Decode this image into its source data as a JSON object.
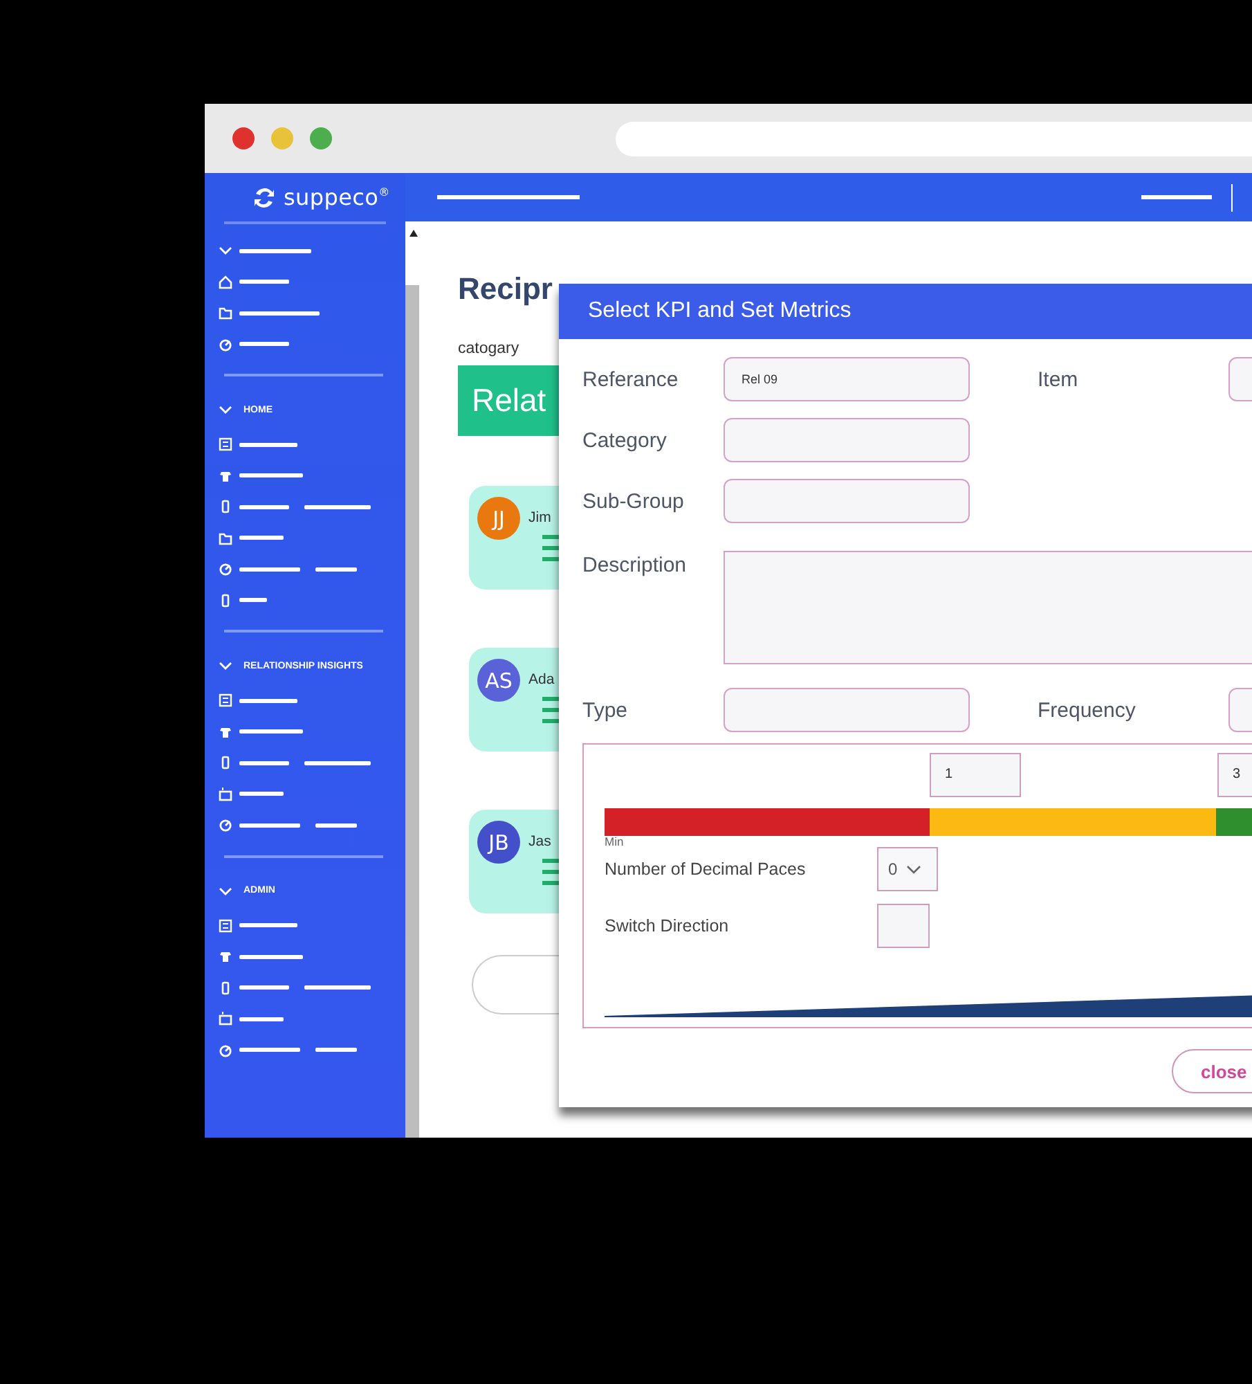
{
  "browser": {
    "dots": [
      {
        "color": "#e0322c"
      },
      {
        "color": "#e8c33a"
      },
      {
        "color": "#4cae4c"
      }
    ]
  },
  "sidebar": {
    "logo": "suppeco$^{®}$",
    "sections": [
      {
        "title": "HOME"
      },
      {
        "title": "RELATIONSHIP INSIGHTS"
      },
      {
        "title": "ADMIN"
      }
    ]
  },
  "page": {
    "title": "Recipr",
    "category_label": "catogary",
    "category_value": "Relat",
    "cards": [
      {
        "initials": "JJ",
        "name": "Jim",
        "color": "#e9780f"
      },
      {
        "initials": "AS",
        "name": "Ada",
        "color": "#5a62d8"
      },
      {
        "initials": "JB",
        "name": "Jas",
        "color": "#4450c9"
      }
    ]
  },
  "modal": {
    "title": "Select KPI and Set Metrics",
    "rows": [
      [
        {
          "label": "Referance",
          "value": "Rel 09"
        },
        {
          "label": "Item"
        }
      ],
      [
        {
          "label": "Category"
        }
      ],
      [
        {
          "label": "Sub-Group"
        }
      ],
      [
        {
          "label": "Description",
          "kind": "textarea"
        }
      ],
      [
        {
          "label": "Type"
        },
        {
          "label": "Frequency"
        }
      ]
    ],
    "metrics": {
      "thresholds": [
        {
          "value": "1"
        },
        {
          "value": "3"
        }
      ],
      "segments": [
        {
          "color": "#d42127"
        },
        {
          "color": "#fcb912"
        },
        {
          "color": "#2f8f2f"
        }
      ],
      "min_label": "Min",
      "decimal_label": "Number of Decimal Paces",
      "decimal_value": "0",
      "switch_label": "Switch Direction"
    },
    "close": "close"
  }
}
